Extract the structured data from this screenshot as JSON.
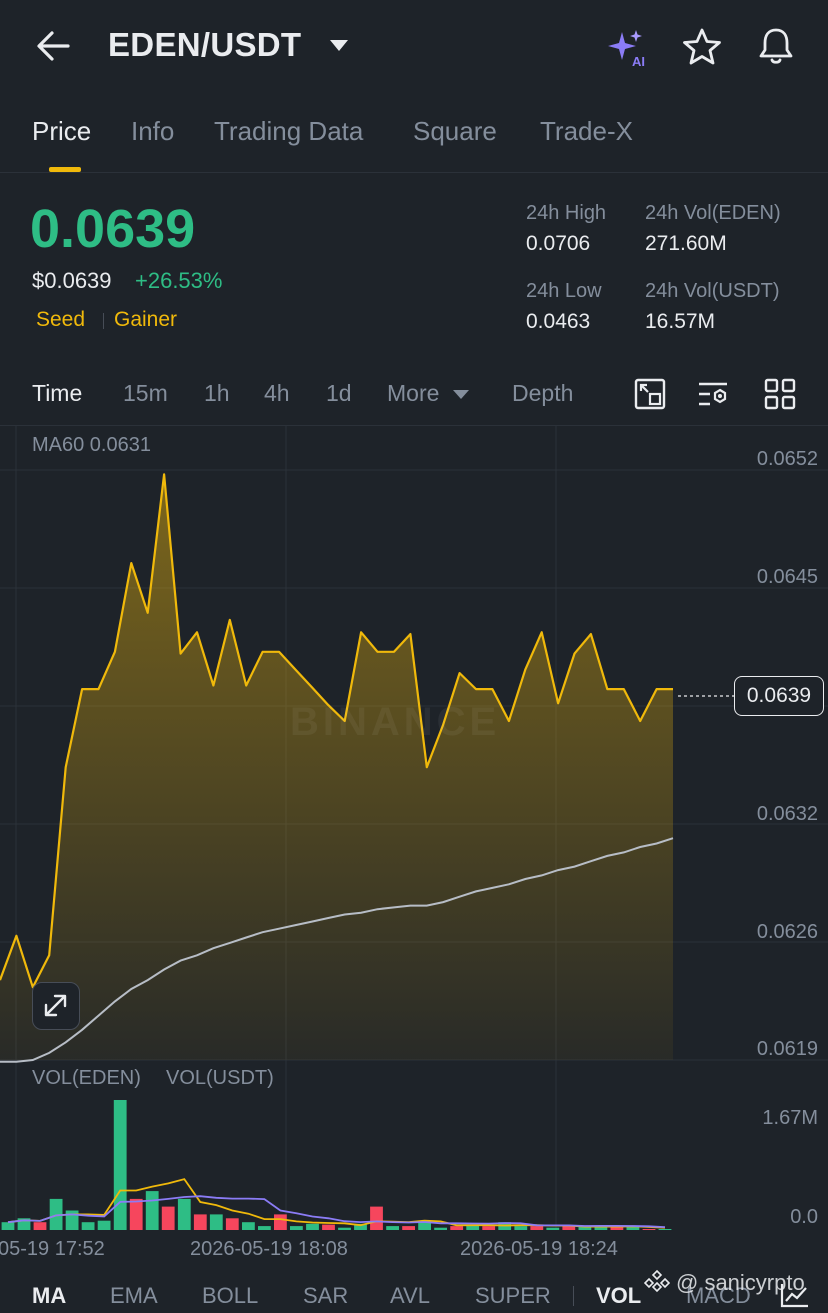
{
  "header": {
    "pair": "EDEN/USDT",
    "icons": {
      "back": "back-arrow-icon",
      "caret": "caret-down-icon",
      "ai": "ai-sparkle-icon",
      "favorite": "star-icon",
      "alerts": "bell-icon"
    },
    "ai_label": "AI"
  },
  "tabs": [
    {
      "label": "Price",
      "active": true
    },
    {
      "label": "Info"
    },
    {
      "label": "Trading Data"
    },
    {
      "label": "Square"
    },
    {
      "label": "Trade-X"
    }
  ],
  "price": {
    "last": "0.0639",
    "usd": "$0.0639",
    "change": "+26.53%",
    "tags": [
      "Seed",
      "Gainer"
    ],
    "up_color": "#2ebd85",
    "accent_color": "#f0b90b"
  },
  "stats": {
    "high_label": "24h High",
    "high_value": "0.0706",
    "low_label": "24h Low",
    "low_value": "0.0463",
    "vol_base_label": "24h Vol(EDEN)",
    "vol_base_value": "271.60M",
    "vol_quote_label": "24h Vol(USDT)",
    "vol_quote_value": "16.57M"
  },
  "intervals": {
    "items": [
      "Time",
      "15m",
      "1h",
      "4h",
      "1d"
    ],
    "active": "Time",
    "more": "More",
    "depth": "Depth",
    "tool_icons": [
      "picture-in-picture-icon",
      "chart-settings-icon",
      "grid-layout-icon"
    ]
  },
  "chart": {
    "ma_label": "MA60 0.0631",
    "y_ticks": [
      "0.0652",
      "0.0645",
      "0.0639",
      "0.0632",
      "0.0626",
      "0.0619"
    ],
    "current_price": "0.0639",
    "x_ticks": [
      "05-19 17:52",
      "2026-05-19 18:08",
      "2026-05-19 18:24"
    ],
    "watermark": "BINANCE",
    "expand_icon": "expand-icon"
  },
  "volume": {
    "labels": [
      "VOL(EDEN)",
      "VOL(USDT)"
    ],
    "y_ticks": [
      "1.67M",
      "0.0"
    ]
  },
  "indicators": {
    "items": [
      "MA",
      "EMA",
      "BOLL",
      "SAR",
      "AVL",
      "SUPER"
    ],
    "sub": [
      "VOL",
      "MACD"
    ],
    "active": [
      "MA",
      "VOL"
    ],
    "chart_type_icon": "line-chart-icon"
  },
  "credit": "@ sanicyrpto",
  "chart_data": {
    "type": "area",
    "price_series": {
      "name": "MA60 0.0631",
      "ylim": [
        0.0619,
        0.06545
      ],
      "values": [
        0.06235,
        0.0626,
        0.06231,
        0.06249,
        0.06355,
        0.06399,
        0.06399,
        0.0642,
        0.0647,
        0.06442,
        0.0652,
        0.06419,
        0.06431,
        0.06401,
        0.06438,
        0.06401,
        0.0642,
        0.0642,
        0.0641,
        0.064,
        0.0639,
        0.06381,
        0.06431,
        0.0642,
        0.0642,
        0.0643,
        0.06355,
        0.06379,
        0.06408,
        0.06399,
        0.06399,
        0.06381,
        0.0641,
        0.06431,
        0.06391,
        0.06419,
        0.0643,
        0.06399,
        0.06399,
        0.06381,
        0.06399,
        0.06399
      ]
    },
    "ma60_series": {
      "values": [
        0.06189,
        0.06189,
        0.0619,
        0.06194,
        0.062,
        0.06207,
        0.06215,
        0.06223,
        0.0623,
        0.06235,
        0.06241,
        0.06246,
        0.06249,
        0.06253,
        0.06256,
        0.06259,
        0.06262,
        0.06264,
        0.06266,
        0.06268,
        0.0627,
        0.06272,
        0.06273,
        0.06275,
        0.06276,
        0.06277,
        0.06277,
        0.06279,
        0.06282,
        0.06285,
        0.06287,
        0.06289,
        0.06292,
        0.06294,
        0.06297,
        0.06299,
        0.06302,
        0.06305,
        0.06307,
        0.0631,
        0.06312,
        0.06315
      ]
    },
    "volume_series": {
      "ylim": [
        0,
        1.67
      ],
      "values": [
        0.1,
        0.15,
        0.1,
        0.4,
        0.25,
        0.1,
        0.12,
        1.67,
        0.4,
        0.5,
        0.3,
        0.4,
        0.2,
        0.2,
        0.15,
        0.1,
        0.05,
        0.2,
        0.05,
        0.08,
        0.07,
        0.03,
        0.08,
        0.3,
        0.05,
        0.05,
        0.12,
        0.03,
        0.05,
        0.06,
        0.05,
        0.1,
        0.05,
        0.05,
        0.03,
        0.05,
        0.04,
        0.05,
        0.05,
        0.05,
        0.0,
        0.0
      ],
      "up": [
        true,
        true,
        false,
        true,
        true,
        true,
        true,
        true,
        false,
        true,
        false,
        true,
        false,
        true,
        false,
        true,
        true,
        false,
        true,
        true,
        false,
        true,
        true,
        false,
        true,
        false,
        true,
        true,
        false,
        true,
        false,
        true,
        true,
        false,
        true,
        false,
        true,
        true,
        false,
        true,
        false,
        true
      ]
    }
  }
}
